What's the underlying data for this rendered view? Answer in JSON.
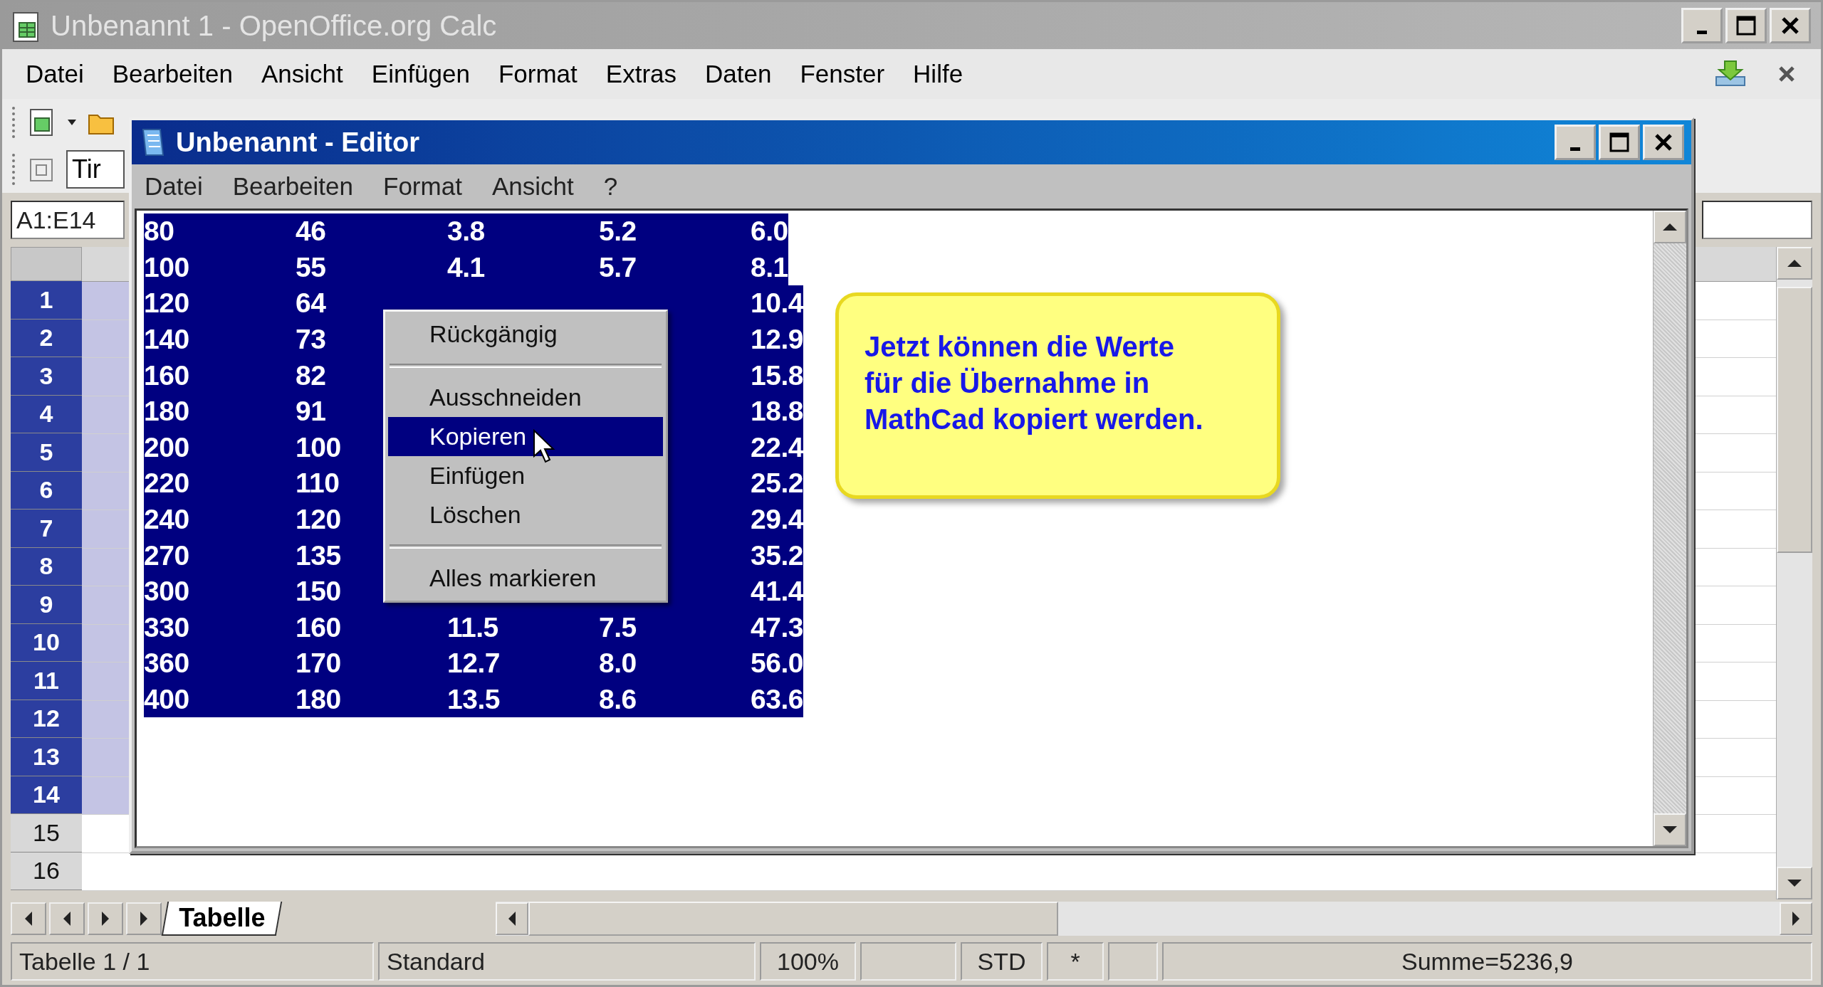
{
  "calc_window": {
    "title": "Unbenannt 1 - OpenOffice.org Calc",
    "menu": [
      "Datei",
      "Bearbeiten",
      "Ansicht",
      "Einfügen",
      "Format",
      "Extras",
      "Daten",
      "Fenster",
      "Hilfe"
    ],
    "font_name_field": {
      "value": "Tir"
    },
    "name_box": {
      "value": "A1:E14"
    },
    "row_headers": [
      {
        "label": "1",
        "selected": true
      },
      {
        "label": "2",
        "selected": true
      },
      {
        "label": "3",
        "selected": true
      },
      {
        "label": "4",
        "selected": true
      },
      {
        "label": "5",
        "selected": true
      },
      {
        "label": "6",
        "selected": true
      },
      {
        "label": "7",
        "selected": true
      },
      {
        "label": "8",
        "selected": true
      },
      {
        "label": "9",
        "selected": true
      },
      {
        "label": "10",
        "selected": true
      },
      {
        "label": "11",
        "selected": true
      },
      {
        "label": "12",
        "selected": true
      },
      {
        "label": "13",
        "selected": true
      },
      {
        "label": "14",
        "selected": true
      },
      {
        "label": "15",
        "selected": false
      },
      {
        "label": "16",
        "selected": false
      }
    ],
    "sheet_tabs": [
      {
        "label": "Tabelle",
        "selected": true
      }
    ],
    "status_bar": {
      "sheet": "Tabelle 1 / 1",
      "page_style": "Standard",
      "zoom": "100%",
      "mode": "STD",
      "modified": "*",
      "sum": "Summe=5236,9"
    }
  },
  "editor_window": {
    "title": "Unbenannt - Editor",
    "menu": [
      "Datei",
      "Bearbeiten",
      "Format",
      "Ansicht",
      "?"
    ],
    "rows": [
      [
        "80",
        "46",
        "3.8",
        "5.2",
        "6.0"
      ],
      [
        "100",
        "55",
        "4.1",
        "5.7",
        "8.1"
      ],
      [
        "120",
        "64",
        null,
        null,
        "10.4"
      ],
      [
        "140",
        "73",
        null,
        null,
        "12.9"
      ],
      [
        "160",
        "82",
        null,
        null,
        "15.8"
      ],
      [
        "180",
        "91",
        null,
        null,
        "18.8"
      ],
      [
        "200",
        "100",
        null,
        null,
        "22.4"
      ],
      [
        "220",
        "110",
        null,
        null,
        "25.2"
      ],
      [
        "240",
        "120",
        null,
        null,
        "29.4"
      ],
      [
        "270",
        "135",
        null,
        null,
        "35.2"
      ],
      [
        "300",
        "150",
        null,
        null,
        "41.4"
      ],
      [
        "330",
        "160",
        "11.5",
        "7.5",
        "47.3"
      ],
      [
        "360",
        "170",
        "12.7",
        "8.0",
        "56.0"
      ],
      [
        "400",
        "180",
        "13.5",
        "8.6",
        "63.6"
      ]
    ]
  },
  "context_menu": {
    "items": [
      {
        "kind": "item",
        "label": "Rückgängig",
        "selected": false
      },
      {
        "kind": "separator"
      },
      {
        "kind": "item",
        "label": "Ausschneiden",
        "selected": false
      },
      {
        "kind": "item",
        "label": "Kopieren",
        "selected": true
      },
      {
        "kind": "item",
        "label": "Einfügen",
        "selected": false
      },
      {
        "kind": "item",
        "label": "Löschen",
        "selected": false
      },
      {
        "kind": "separator"
      },
      {
        "kind": "item",
        "label": "Alles markieren",
        "selected": false
      }
    ]
  },
  "callout": {
    "text": "Jetzt können die Werte für die Übernahme in MathCad kopiert werden."
  }
}
